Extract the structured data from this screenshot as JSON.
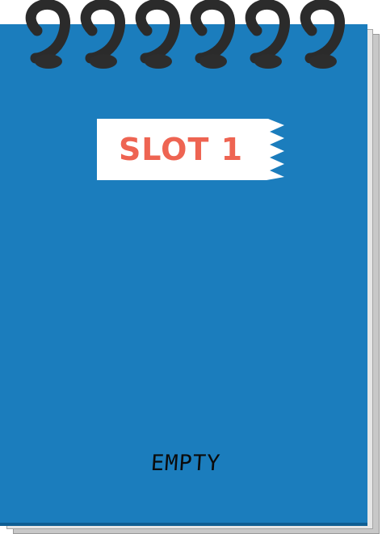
{
  "slot": {
    "label": "SLOT 1",
    "status": "EMPTY"
  },
  "colors": {
    "cover": "#1b7dbd",
    "label_text": "#ee6452",
    "label_tape": "#ffffff",
    "ring": "#2b2b2b"
  },
  "icons": {
    "binding": "spiral-ring-icon"
  }
}
